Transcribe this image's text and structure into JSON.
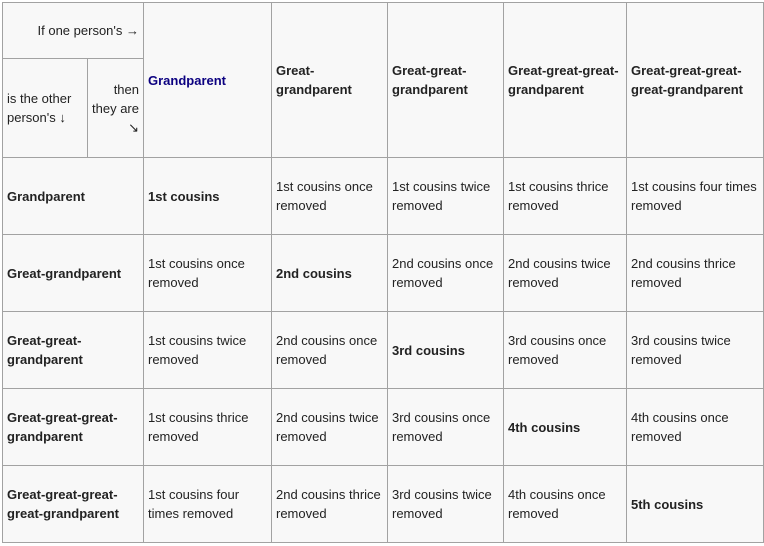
{
  "corner": {
    "top": "If one person's →",
    "left": "is the other person's ↓",
    "right": "then they are ↘"
  },
  "columns": [
    "Grandparent",
    "Great-grandparent",
    "Great-great-grandparent",
    "Great-great-great-grandparent",
    "Great-great-great-great-grandparent"
  ],
  "link_color": "#0b0080",
  "rows": [
    {
      "label": "Grandparent",
      "cells": [
        "1st cousins",
        "1st cousins once removed",
        "1st cousins twice removed",
        "1st cousins thrice removed",
        "1st cousins four times removed"
      ]
    },
    {
      "label": "Great-grandparent",
      "cells": [
        "1st cousins once removed",
        "2nd cousins",
        "2nd cousins once removed",
        "2nd cousins twice removed",
        "2nd cousins thrice removed"
      ]
    },
    {
      "label": "Great-great-grandparent",
      "cells": [
        "1st cousins twice removed",
        "2nd cousins once removed",
        "3rd cousins",
        "3rd cousins once removed",
        "3rd cousins twice removed"
      ]
    },
    {
      "label": "Great-great-great-grandparent",
      "cells": [
        "1st cousins thrice removed",
        "2nd cousins twice removed",
        "3rd cousins once removed",
        "4th cousins",
        "4th cousins once removed"
      ]
    },
    {
      "label": "Great-great-great-great-grandparent",
      "cells": [
        "1st cousins four times removed",
        "2nd cousins thrice removed",
        "3rd cousins twice removed",
        "4th cousins once removed",
        "5th cousins"
      ]
    }
  ]
}
